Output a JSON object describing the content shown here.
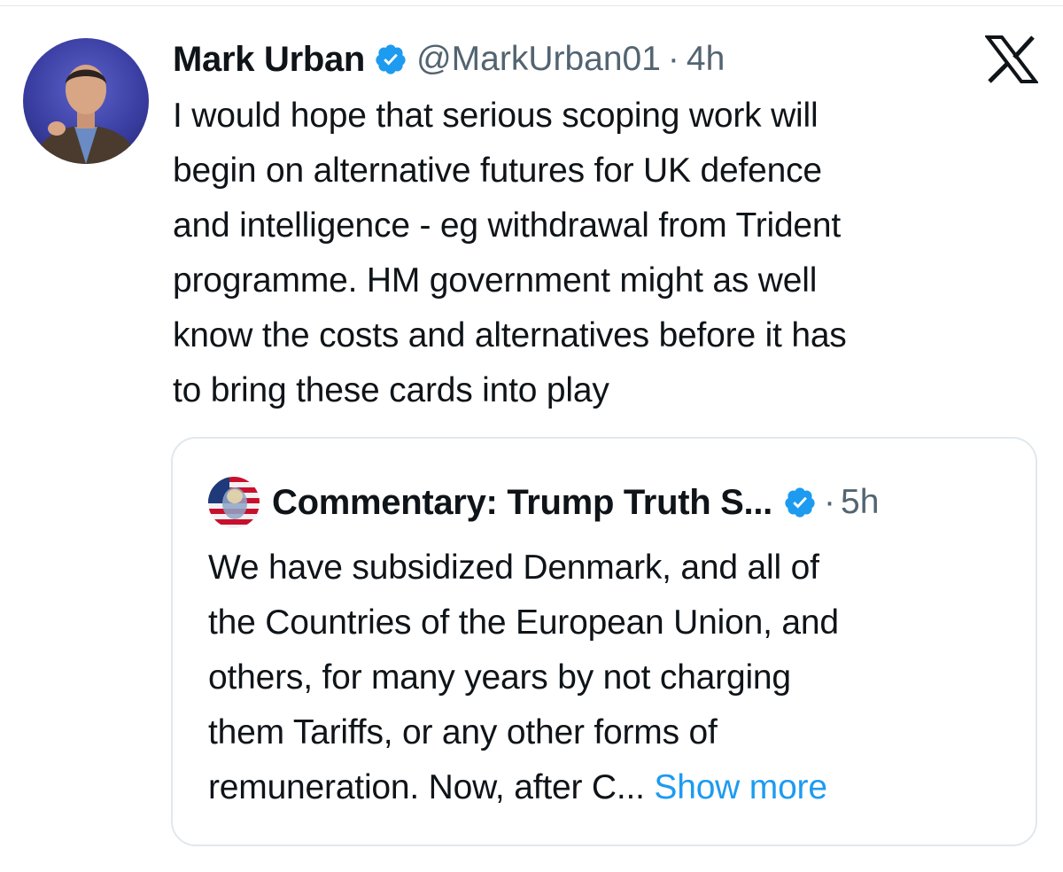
{
  "tweet": {
    "author_name": "Mark Urban",
    "handle": "@MarkUrban01",
    "separator": "·",
    "time": "4h",
    "avatar_icon": "user-photo-avatar",
    "verified_icon": "verified-badge-icon",
    "text": "I would hope that serious scoping work will\nbegin on alternative futures for UK defence\nand intelligence - eg withdrawal from Trident\nprogramme. HM government might as well\nknow the costs and alternatives before it has\nto bring these cards into play"
  },
  "platform": {
    "logo_icon": "x-logo-icon"
  },
  "quoted_tweet": {
    "author_name": "Commentary: Trump Truth S...",
    "separator": "·",
    "time": "5h",
    "avatar_icon": "flag-portrait-avatar",
    "verified_icon": "verified-badge-icon",
    "text": "We have subsidized Denmark, and all of\nthe Countries of the European Union, and\nothers, for many years by not charging\nthem Tariffs, or any other forms of\nremuneration. Now, after C... ",
    "show_more_label": "Show more"
  },
  "colors": {
    "verified_blue": "#1d9bf0",
    "link_blue": "#1d9bf0",
    "secondary_text": "#536471",
    "primary_text": "#0f1419"
  }
}
